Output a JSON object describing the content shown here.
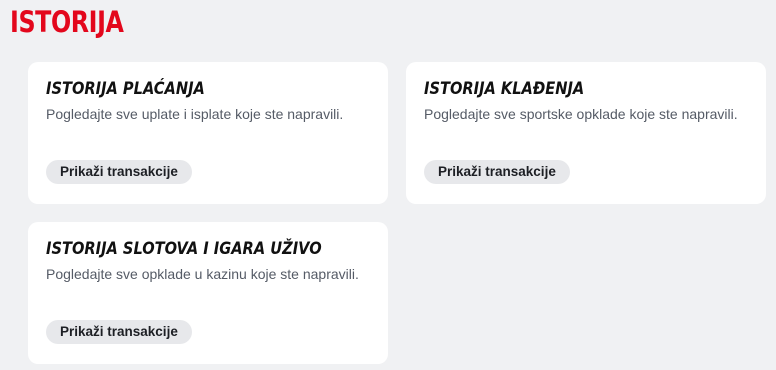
{
  "page": {
    "title": "ISTORIJA"
  },
  "cards": [
    {
      "title": "ISTORIJA PLAĆANJA",
      "description": "Pogledajte sve uplate i isplate koje ste napravili.",
      "button_label": "Prikaži transakcije"
    },
    {
      "title": "ISTORIJA KLAĐENJA",
      "description": "Pogledajte sve sportske opklade koje ste napravili.",
      "button_label": "Prikaži transakcije"
    },
    {
      "title": "ISTORIJA SLOTOVA I IGARA UŽIVO",
      "description": "Pogledajte sve opklade u kazinu koje ste napravili.",
      "button_label": "Prikaži transakcije"
    }
  ],
  "colors": {
    "accent": "#e3071c",
    "background": "#f0f1f3",
    "card": "#ffffff",
    "button": "#e7e8eb"
  }
}
